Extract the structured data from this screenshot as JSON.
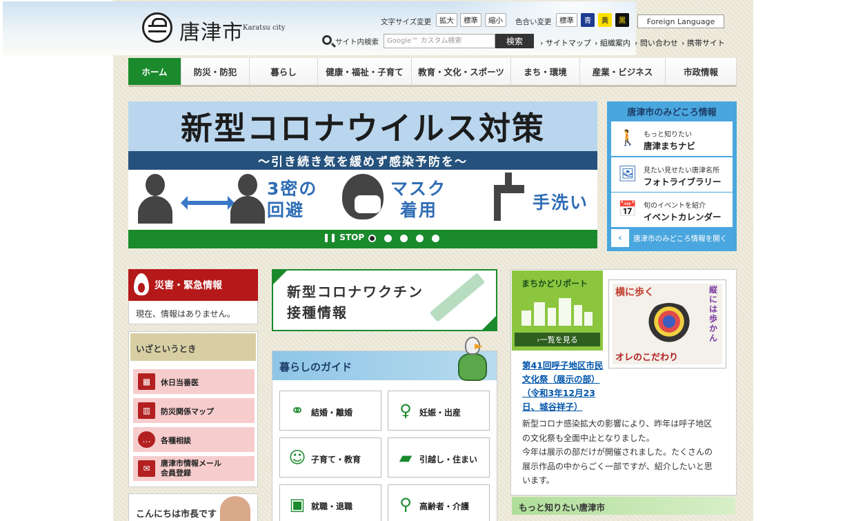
{
  "header": {
    "logo_text": "唐津市",
    "logo_sub": "Karatsu city",
    "font_size_label": "文字サイズ変更",
    "font_sizes": [
      "拡大",
      "標準",
      "縮小"
    ],
    "color_label": "色合い変更",
    "color_options": [
      "標準",
      "青",
      "黄",
      "黒"
    ],
    "foreign_language": "Foreign Language",
    "search_label": "サイト内検索",
    "search_placeholder": "Google™ カスタム検索",
    "search_button": "検索",
    "links": [
      "サイトマップ",
      "組織案内",
      "問い合わせ",
      "携帯サイト"
    ]
  },
  "nav": [
    "ホーム",
    "防災・防犯",
    "暮らし",
    "健康・福祉・子育て",
    "教育・文化・スポーツ",
    "まち・環境",
    "産業・ビジネス",
    "市政情報"
  ],
  "slider": {
    "title": "新型コロナウイルス対策",
    "subtitle": "～引き続き気を緩めず感染予防を～",
    "avoid": [
      "3密の",
      "回避"
    ],
    "mask": [
      "マスク",
      "着用"
    ],
    "handwash": "手洗い",
    "stop": "STOP",
    "dots": 5,
    "active_dot": 0
  },
  "sights": {
    "title": "唐津市のみどころ情報",
    "items": [
      {
        "small": "もっと知りたい",
        "big": "唐津まちナビ",
        "icon": "walking-person-icon"
      },
      {
        "small": "見たい見せたい唐津名所",
        "big": "フォトライブラリー",
        "icon": "photo-icon"
      },
      {
        "small": "旬のイベントを紹介",
        "big": "イベントカレンダー",
        "icon": "calendar-icon"
      }
    ],
    "open_label": "唐津市のみどころ情報を開く"
  },
  "emergency": {
    "title": "災害・緊急情報",
    "body": "現在、情報はありません。"
  },
  "izato": {
    "title": "いざというとき",
    "items": [
      "休日当番医",
      "防災関係マップ",
      "各種相談",
      "唐津市情報メール\n会員登録"
    ],
    "item_lines": [
      [
        "休日当番医"
      ],
      [
        "防災関係マップ"
      ],
      [
        "各種相談"
      ],
      [
        "唐津市情報メール",
        "会員登録"
      ]
    ]
  },
  "mayor": {
    "title": "こんにちは市長です"
  },
  "vaccine": {
    "line1": "新型コロナワクチン",
    "line2": "接種情報"
  },
  "guide": {
    "title": "暮らしのガイド",
    "items": [
      "結婚・離婚",
      "妊娠・出産",
      "子育て・教育",
      "引越し・住まい",
      "就職・退職",
      "高齢者・介護"
    ]
  },
  "report": {
    "badge_title": "まちかどリポート",
    "more": "一覧を見る",
    "photo_text": [
      "横に歩く",
      "縦には歩かん",
      "オレのこだわり"
    ],
    "link": "第41回呼子地区市民文化祭（展示の部）（令和3年12月23日、城谷祥子）",
    "link_lines": [
      "第41回呼子地区市民",
      "文化祭（展示の部）",
      "（令和3年12月23",
      "日、城谷祥子）"
    ],
    "body_lines": [
      "新型コロナ感染拡大の影響により、昨年は呼子地区",
      "の文化祭も全面中止となりました。",
      "今年は展示の部だけが開催されました。たくさんの",
      "展示作品の中からごく一部ですが、紹介したいと思",
      "います。"
    ]
  },
  "motto": {
    "title": "もっと知りたい唐津市"
  },
  "colors": {
    "brand_green": "#1a8a2c",
    "emergency_red": "#b51818",
    "sights_blue": "#4aa6de"
  }
}
